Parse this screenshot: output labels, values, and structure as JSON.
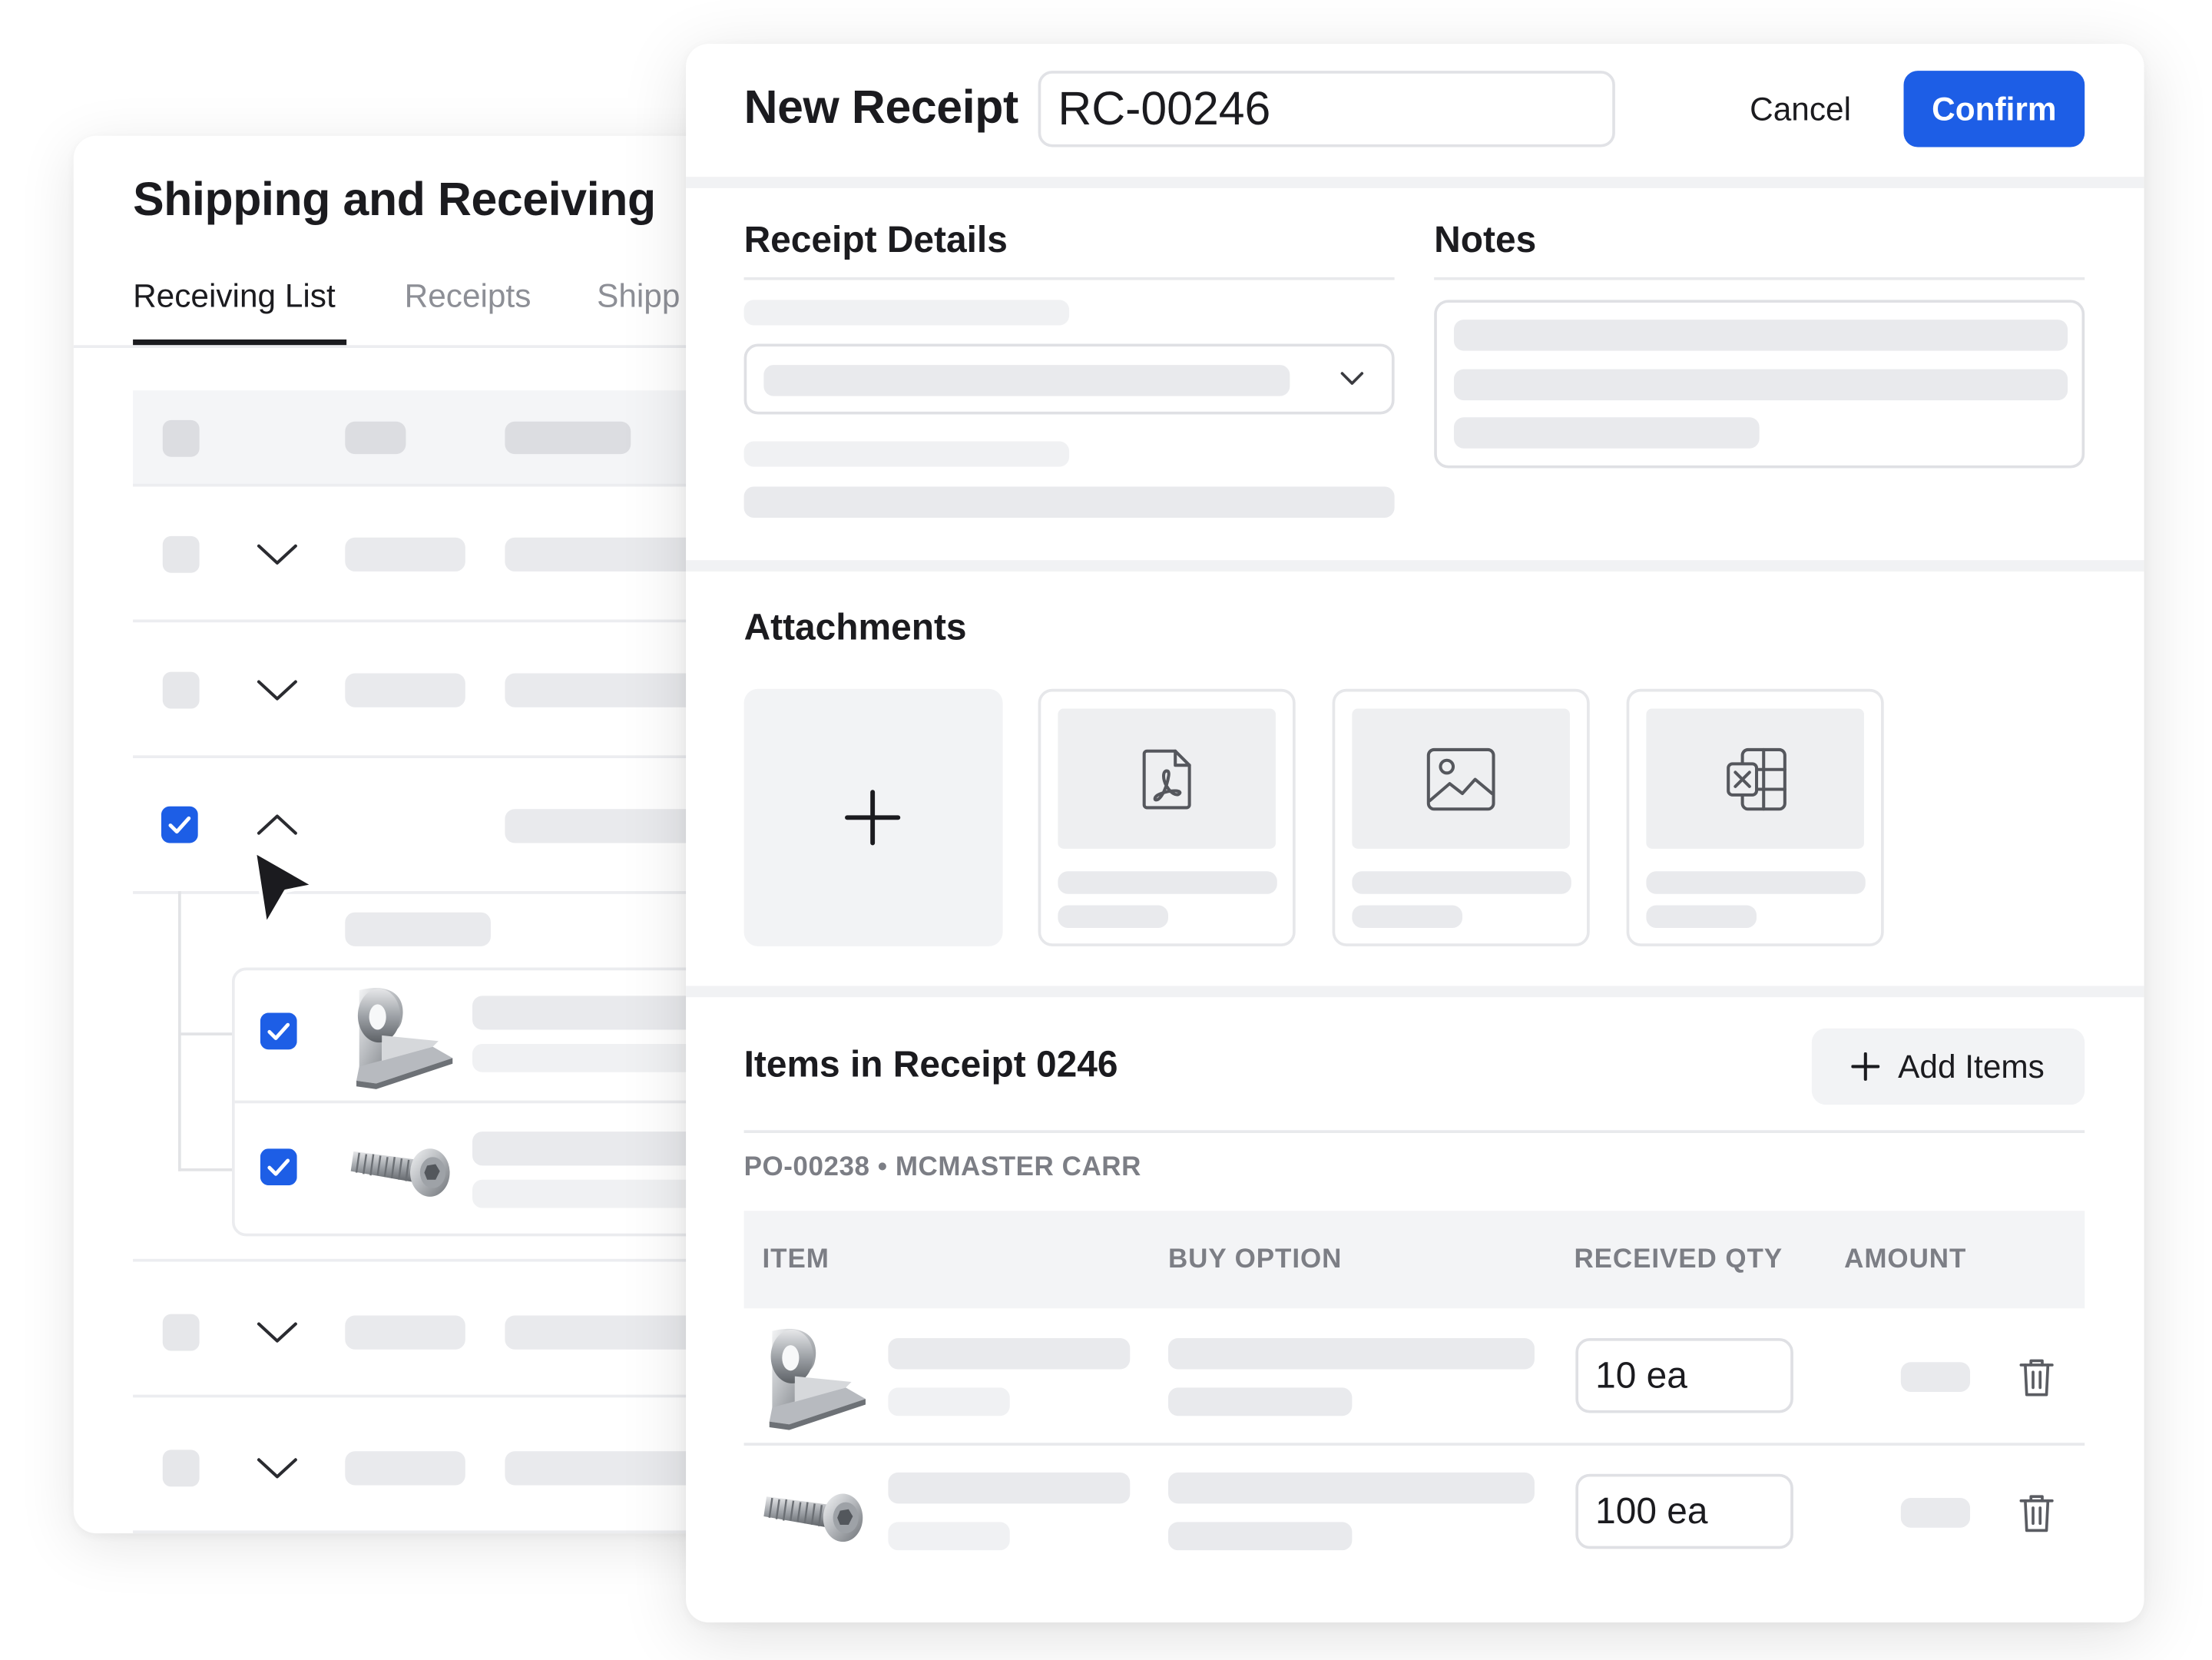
{
  "back_panel": {
    "title": "Shipping and Receiving",
    "tabs": [
      {
        "label": "Receiving List",
        "active": true
      },
      {
        "label": "Receipts",
        "active": false
      },
      {
        "label": "Shipp",
        "active": false
      }
    ],
    "rows": [
      {
        "checked": false,
        "expanded": false
      },
      {
        "checked": false,
        "expanded": false
      },
      {
        "checked": true,
        "expanded": true,
        "children": [
          {
            "checked": true,
            "icon": "sheet-metal-roll-image"
          },
          {
            "checked": true,
            "icon": "hex-bolt-image"
          }
        ]
      },
      {
        "checked": false,
        "expanded": false
      },
      {
        "checked": false,
        "expanded": false
      }
    ]
  },
  "receipt": {
    "title": "New Receipt",
    "number": "RC-00246",
    "cancel_label": "Cancel",
    "confirm_label": "Confirm",
    "details_title": "Receipt Details",
    "notes_title": "Notes",
    "attachments_title": "Attachments",
    "attachments": [
      {
        "icon": "pdf-file-icon"
      },
      {
        "icon": "image-file-icon"
      },
      {
        "icon": "spreadsheet-file-icon"
      }
    ],
    "items_title": "Items in Receipt 0246",
    "add_items_label": "Add Items",
    "po_label": "PO-00238 • MCMASTER CARR",
    "columns": {
      "item": "ITEM",
      "buy_option": "BUY OPTION",
      "received_qty": "RECEIVED QTY",
      "amount": "AMOUNT"
    },
    "items": [
      {
        "icon": "sheet-metal-roll-image",
        "received_qty": "10 ea"
      },
      {
        "icon": "hex-bolt-image",
        "received_qty": "100 ea"
      }
    ]
  },
  "colors": {
    "accent": "#1d5ee6",
    "text": "#1b1b1f",
    "muted": "#7c7e85",
    "skeleton": "#e9eaed"
  }
}
